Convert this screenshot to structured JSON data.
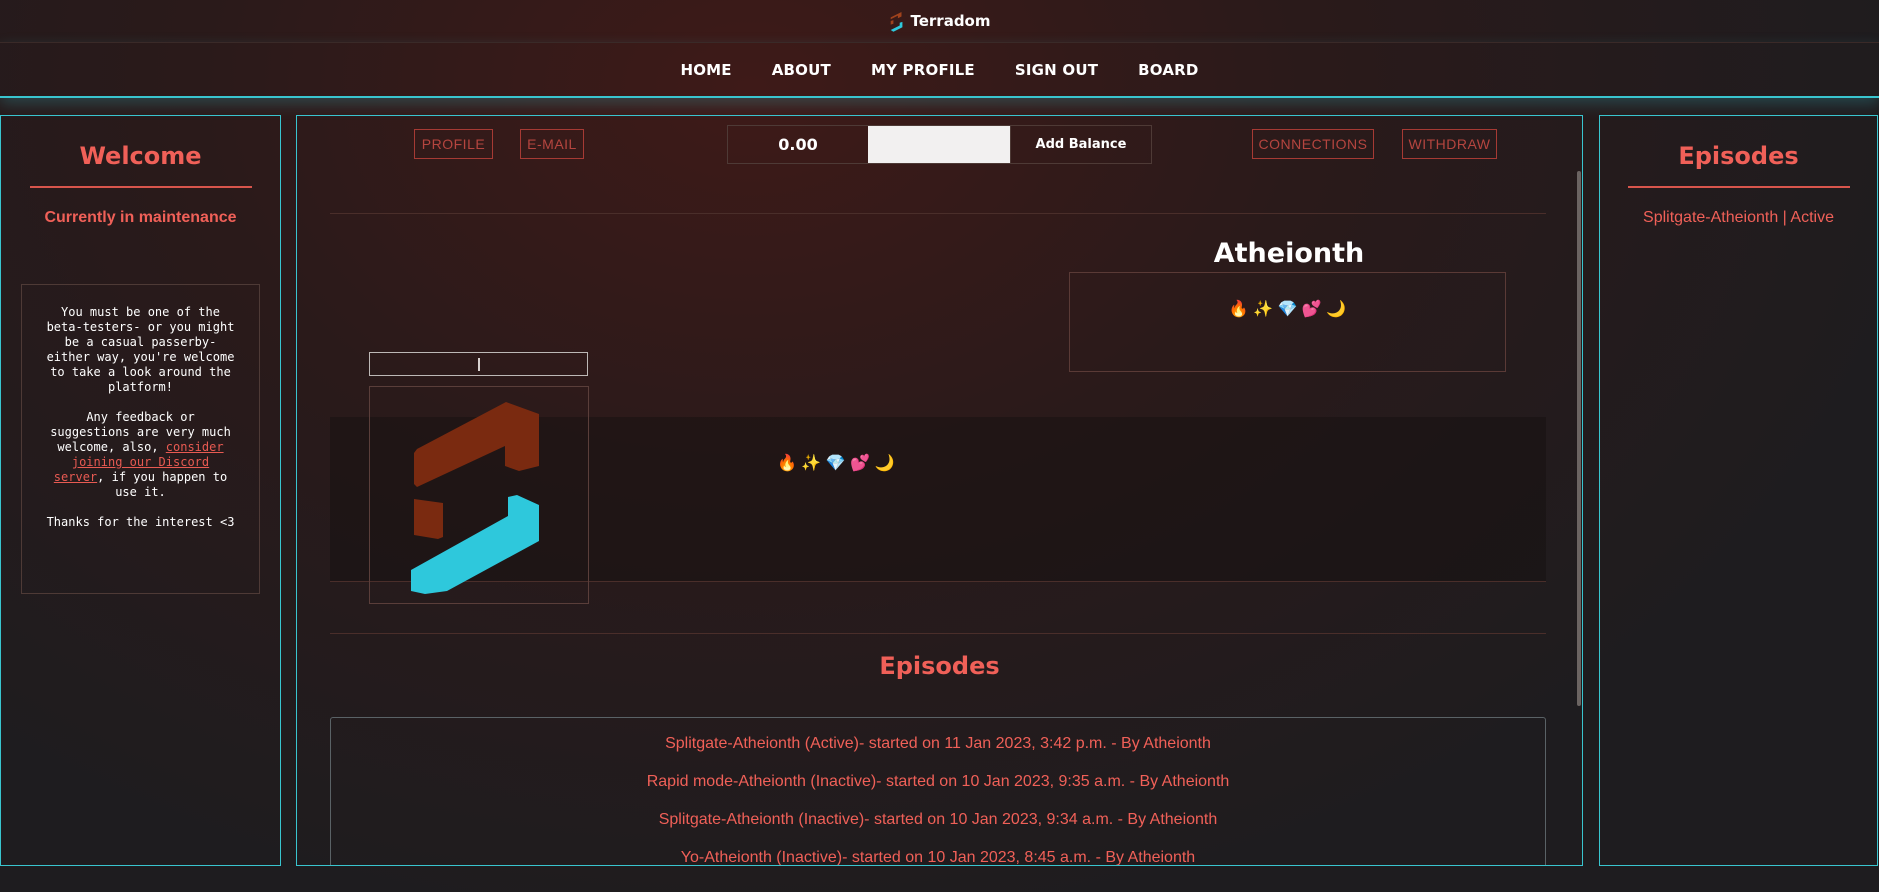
{
  "brand": {
    "name": "Terradom"
  },
  "nav": {
    "items": [
      {
        "label": "HOME"
      },
      {
        "label": "ABOUT"
      },
      {
        "label": "MY PROFILE"
      },
      {
        "label": "SIGN OUT"
      },
      {
        "label": "BOARD"
      }
    ]
  },
  "left_panel": {
    "title": "Welcome",
    "maintenance": "Currently in maintenance",
    "notice": {
      "p1": "You must be one of the beta-testers- or you might be a casual passerby- either way, you're welcome to take a look around the platform!",
      "p2_before": "Any feedback or suggestions are very much welcome, also, ",
      "p2_link": "consider joining our Discord server",
      "p2_after": ", if you happen to use it.",
      "p3": "Thanks for the interest <3"
    }
  },
  "right_panel": {
    "title": "Episodes",
    "link": "Splitgate-Atheionth | Active"
  },
  "main": {
    "buttons": {
      "profile": "PROFILE",
      "email": "E-MAIL",
      "connections": "CONNECTIONS",
      "withdraw": "WITHDRAW"
    },
    "balance": {
      "value": "0.00",
      "input_value": "",
      "add_label": "Add Balance"
    },
    "username": "Atheionth",
    "bio": "🔥 ✨ 💎 💕 🌙",
    "status": "🔥 ✨ 💎 💕 🌙",
    "episodes_title": "Episodes",
    "episodes": [
      "Splitgate-Atheionth (Active)- started on 11 Jan 2023, 3:42 p.m. - By Atheionth",
      "Rapid mode-Atheionth (Inactive)- started on 10 Jan 2023, 9:35 a.m. - By Atheionth",
      "Splitgate-Atheionth (Inactive)- started on 10 Jan 2023, 9:34 a.m. - By Atheionth",
      "Yo-Atheionth (Inactive)- started on 10 Jan 2023, 8:45 a.m. - By Atheionth"
    ]
  },
  "colors": {
    "accent_cyan": "#39c5cf",
    "accent_red": "#f06058",
    "logo_brown": "#7a2a10",
    "logo_cyan": "#2ec8dc"
  },
  "icons": {
    "brand_logo": "terradom-logo-icon",
    "avatar": "terradom-logo-icon"
  }
}
